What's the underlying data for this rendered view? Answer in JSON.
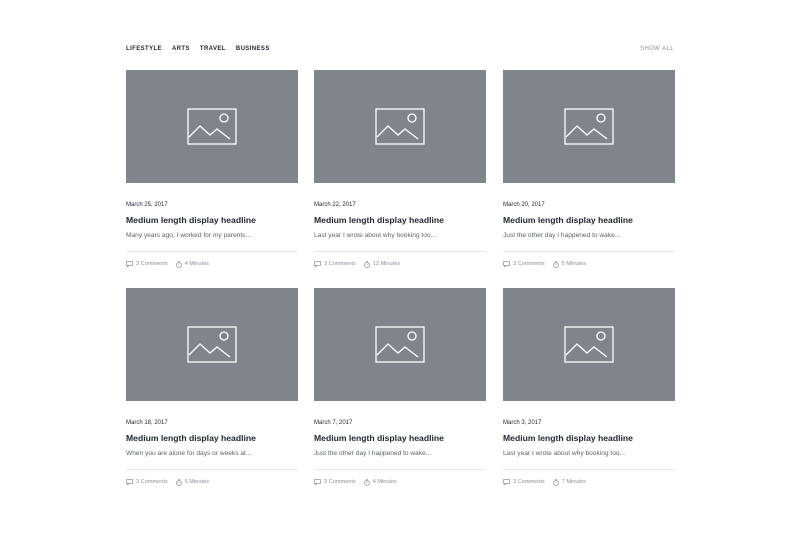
{
  "filters": {
    "categories": [
      "LIFESTYLE",
      "ARTS",
      "TRAVEL",
      "BUSINESS"
    ],
    "show_all_label": "SHOW ALL"
  },
  "posts": [
    {
      "date": "March 25, 2017",
      "headline": "Medium length display headline",
      "excerpt": "Many years ago, I worked for my parents...",
      "comments": "3 Comments",
      "read_time": "4 Minutes"
    },
    {
      "date": "March 22, 2017",
      "headline": "Medium length display headline",
      "excerpt": "Last year I wrote about why booking too...",
      "comments": "3 Comments",
      "read_time": "12 Minutes"
    },
    {
      "date": "March 20, 2017",
      "headline": "Medium length display headline",
      "excerpt": "Just the other day I happened to wake...",
      "comments": "3 Comments",
      "read_time": "5 Minutes"
    },
    {
      "date": "March 18, 2017",
      "headline": "Medium length display headline",
      "excerpt": "When you are alone for days or weeks at...",
      "comments": "3 Comments",
      "read_time": "5 Minutes"
    },
    {
      "date": "March 7, 2017",
      "headline": "Medium length display headline",
      "excerpt": "Just the other day I happened to wake...",
      "comments": "3 Comments",
      "read_time": "4 Minutes"
    },
    {
      "date": "March 3, 2017",
      "headline": "Medium length display headline",
      "excerpt": "Last year I wrote about why booking too...",
      "comments": "3 Comments",
      "read_time": "7 Minutes"
    }
  ],
  "icons": {
    "thumbnail": "image-placeholder-icon",
    "comments": "comment-icon",
    "read_time": "stopwatch-icon"
  },
  "colors": {
    "thumbnail_bg": "#80858c",
    "text_primary": "#1f2430",
    "text_muted": "#8a8f98"
  }
}
